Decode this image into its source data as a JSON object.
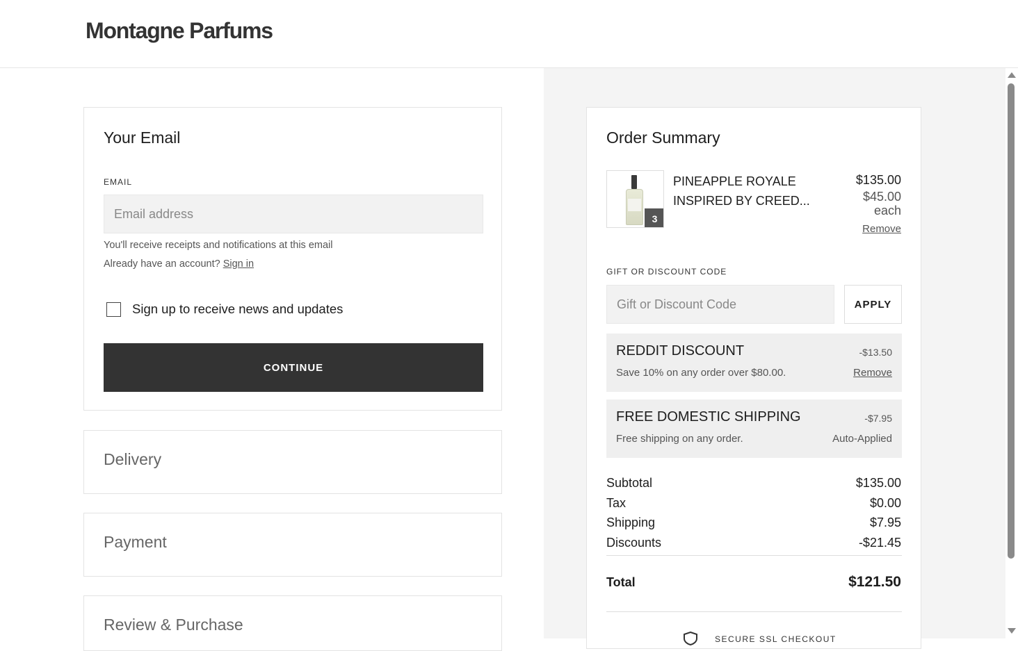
{
  "header": {
    "brand": "Montagne Parfums"
  },
  "email_section": {
    "title": "Your Email",
    "email_label": "EMAIL",
    "email_placeholder": "Email address",
    "email_value": "",
    "receipt_note": "You'll receive receipts and notifications at this email",
    "account_prompt": "Already have an account?",
    "sign_in_link": "Sign in",
    "newsletter_label": "Sign up to receive news and updates",
    "newsletter_checked": false,
    "continue_label": "CONTINUE"
  },
  "sections": {
    "delivery": "Delivery",
    "payment": "Payment",
    "review": "Review & Purchase"
  },
  "order_summary": {
    "title": "Order Summary",
    "item": {
      "name": "PINEAPPLE ROYALE INSPIRED BY CREED...",
      "quantity": "3",
      "line_total": "$135.00",
      "unit_price": "$45.00",
      "unit_suffix": "each",
      "remove_label": "Remove"
    },
    "discount_code": {
      "label": "GIFT OR DISCOUNT CODE",
      "placeholder": "Gift or Discount Code",
      "apply_label": "APPLY"
    },
    "discounts": [
      {
        "title": "REDDIT DISCOUNT",
        "description": "Save 10% on any order over $80.00.",
        "amount": "-$13.50",
        "action": "Remove"
      },
      {
        "title": "FREE DOMESTIC SHIPPING",
        "description": "Free shipping on any order.",
        "amount": "-$7.95",
        "action": "Auto-Applied"
      }
    ],
    "totals": {
      "subtotal_label": "Subtotal",
      "subtotal": "$135.00",
      "tax_label": "Tax",
      "tax": "$0.00",
      "shipping_label": "Shipping",
      "shipping": "$7.95",
      "discounts_label": "Discounts",
      "discounts": "-$21.45",
      "total_label": "Total",
      "total": "$121.50"
    },
    "secure_text": "SECURE SSL CHECKOUT"
  },
  "icons": {
    "secure": "shield-icon",
    "qty": "quantity-badge"
  }
}
